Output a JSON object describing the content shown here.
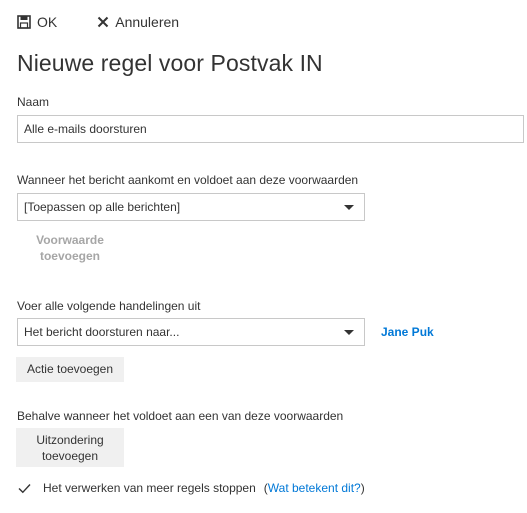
{
  "toolbar": {
    "ok_label": "OK",
    "cancel_label": "Annuleren"
  },
  "page": {
    "title": "Nieuwe regel voor Postvak IN"
  },
  "name_field": {
    "label": "Naam",
    "value": "Alle e-mails doorsturen"
  },
  "conditions": {
    "label": "Wanneer het bericht aankomt en voldoet aan deze voorwaarden",
    "selected": "[Toepassen op alle berichten]",
    "add_button": [
      "Voorwaarde",
      "toevoegen"
    ]
  },
  "actions": {
    "label": "Voer alle volgende handelingen uit",
    "selected": "Het bericht doorsturen naar...",
    "recipient": "Jane Puk",
    "add_button": "Actie toevoegen"
  },
  "exceptions": {
    "label": "Behalve wanneer het voldoet aan een van deze voorwaarden",
    "add_button": [
      "Uitzondering",
      "toevoegen"
    ]
  },
  "stop_processing": {
    "checked": true,
    "label": "Het verwerken van meer regels stoppen",
    "help_prefix": "(",
    "help_link": "Wat betekent dit?",
    "help_suffix": ")"
  },
  "icons": {
    "save": "save-icon",
    "cancel": "close-icon",
    "check": "checkmark-icon"
  },
  "colors": {
    "link": "#0078d7",
    "button_bg": "#f0f0f0",
    "disabled_text": "#a6a6a6"
  }
}
